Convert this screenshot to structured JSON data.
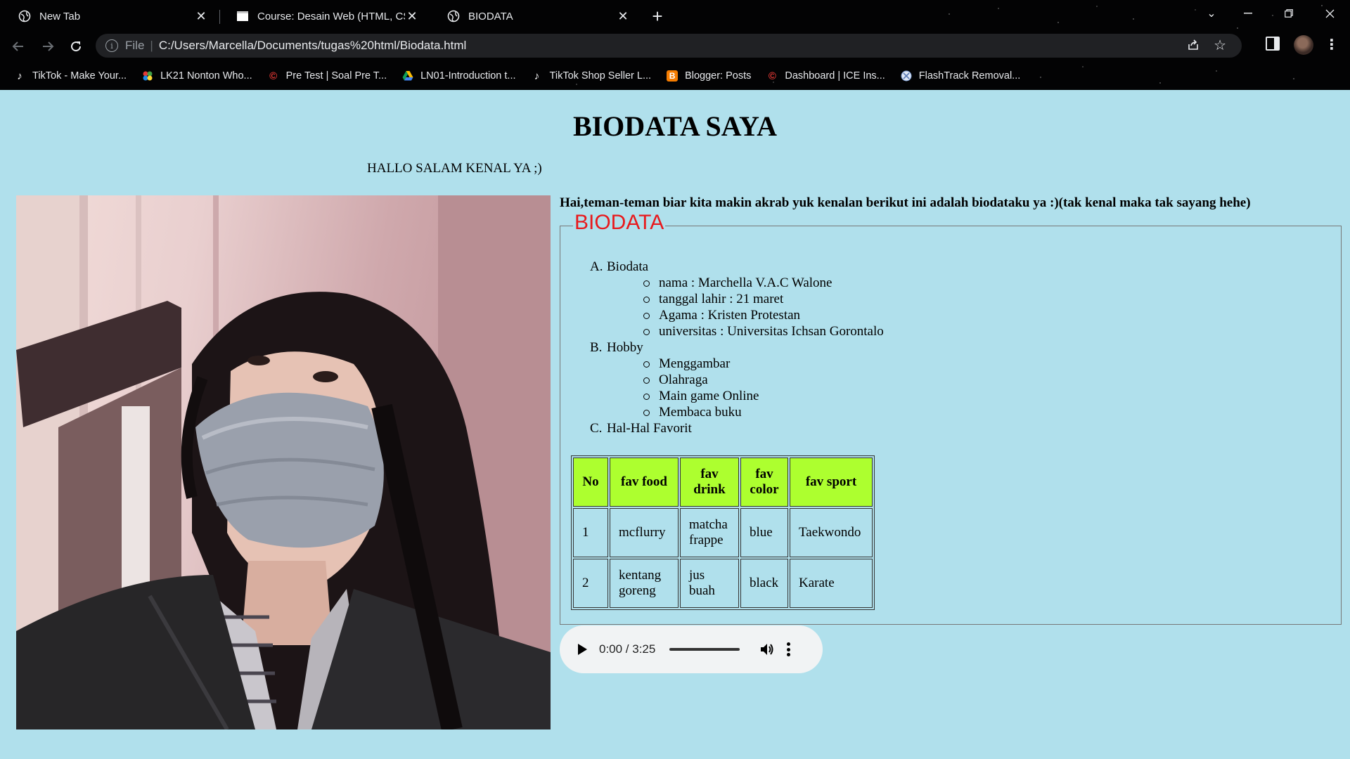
{
  "browser": {
    "tabs": [
      {
        "title": "New Tab",
        "active": false
      },
      {
        "title": "Course: Desain Web (HTML, CSS)",
        "active": false
      },
      {
        "title": "BIODATA",
        "active": true
      }
    ],
    "address": {
      "scheme_label": "File",
      "url": "C:/Users/Marcella/Documents/tugas%20html/Biodata.html"
    },
    "bookmarks": [
      {
        "label": "TikTok - Make Your...",
        "icon": "tiktok-icon"
      },
      {
        "label": "LK21 Nonton Who...",
        "icon": "lk21-icon"
      },
      {
        "label": "Pre Test | Soal Pre T...",
        "icon": "pretest-icon"
      },
      {
        "label": "LN01-Introduction t...",
        "icon": "google-drive-icon"
      },
      {
        "label": "TikTok Shop Seller L...",
        "icon": "tiktok-icon"
      },
      {
        "label": "Blogger: Posts",
        "icon": "blogger-icon"
      },
      {
        "label": "Dashboard | ICE Ins...",
        "icon": "ice-icon"
      },
      {
        "label": "FlashTrack Removal...",
        "icon": "flashtrack-icon"
      }
    ]
  },
  "page": {
    "title": "BIODATA SAYA",
    "greeting": "HALLO SALAM KENAL YA ;)",
    "intro": "Hai,teman-teman biar kita makin akrab yuk kenalan berikut ini adalah biodataku ya :)(tak kenal maka tak sayang hehe)",
    "fieldset_legend": "BIODATA",
    "sections": [
      {
        "marker": "A.",
        "label": "Biodata",
        "items": [
          "nama : Marchella V.A.C Walone",
          "tanggal lahir : 21 maret",
          "Agama : Kristen Protestan",
          "universitas : Universitas Ichsan Gorontalo"
        ]
      },
      {
        "marker": "B.",
        "label": "Hobby",
        "items": [
          "Menggambar",
          "Olahraga",
          "Main game Online",
          "Membaca buku"
        ]
      },
      {
        "marker": "C.",
        "label": "Hal-Hal Favorit",
        "items": []
      }
    ],
    "table": {
      "headers": [
        "No",
        "fav food",
        "fav drink",
        "fav color",
        "fav sport"
      ],
      "rows": [
        [
          "1",
          "mcflurry",
          "matcha frappe",
          "blue",
          "Taekwondo"
        ],
        [
          "2",
          "kentang goreng",
          "jus buah",
          "black",
          "Karate"
        ]
      ]
    },
    "audio": {
      "time": "0:00 / 3:25"
    }
  },
  "colors": {
    "page_background": "#b0e0ec",
    "legend_text": "#e8191c",
    "table_header": "#adff2f"
  }
}
